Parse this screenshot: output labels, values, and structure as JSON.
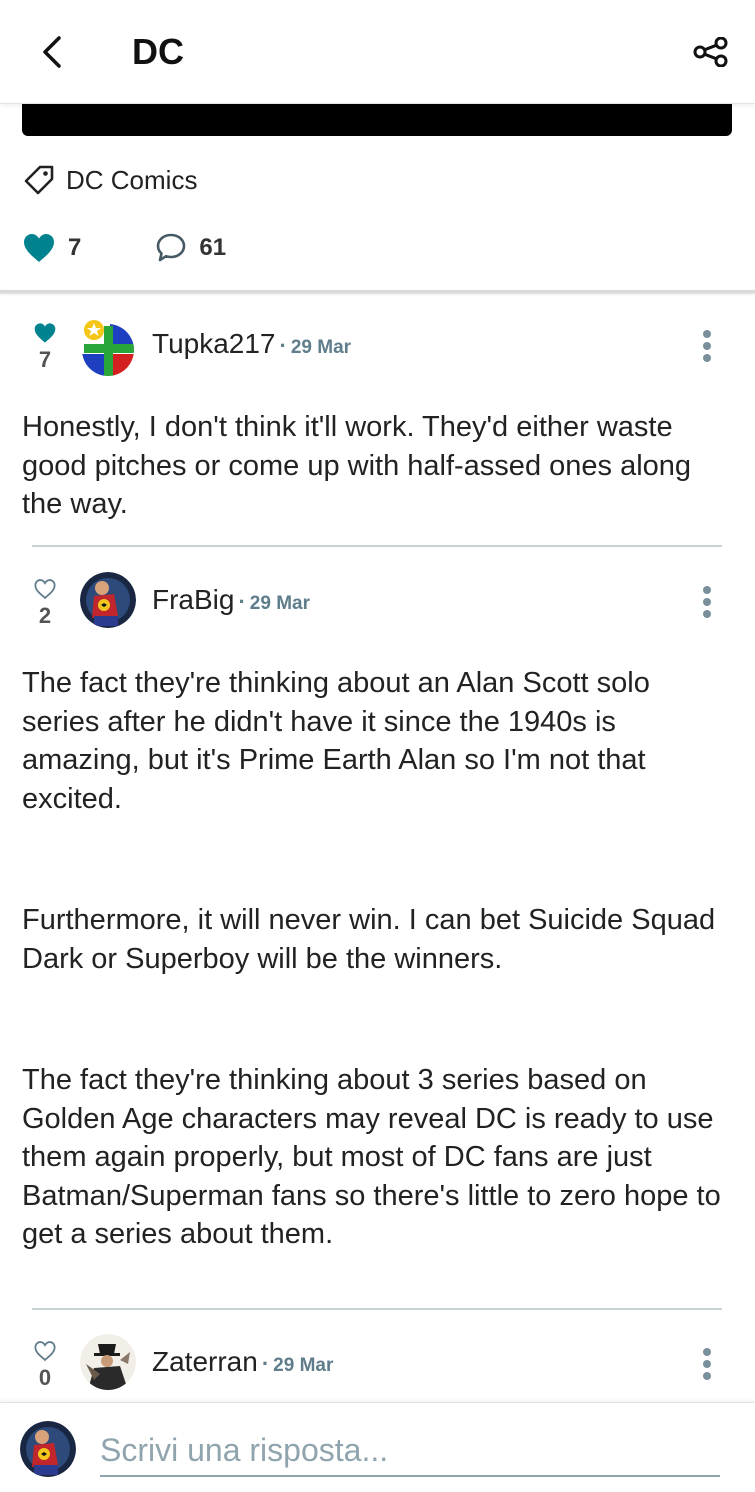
{
  "header": {
    "title": "DC",
    "back_icon": "chevron-left-icon",
    "share_icon": "share-icon"
  },
  "post": {
    "tag": "DC Comics",
    "likes": "7",
    "comments": "61"
  },
  "comments": [
    {
      "likes": "7",
      "liked": true,
      "username": "Tupka217",
      "date": "29 Mar",
      "paragraphs": [
        "Honestly, I don't think it'll work. They'd either waste good pitches or come up with half-assed ones along the way."
      ]
    },
    {
      "likes": "2",
      "liked": false,
      "username": "FraBig",
      "date": "29 Mar",
      "paragraphs": [
        "The fact they're thinking about an Alan Scott solo series after he didn't have it since the 1940s is amazing, but it's Prime Earth Alan so I'm not that excited.",
        "Furthermore, it will never win. I can bet Suicide Squad Dark or Superboy will be the winners.",
        "The fact they're thinking about 3 series based on Golden Age characters may reveal DC is ready to use them again properly, but most of DC fans are just Batman/Superman fans so there's little to zero hope to get a series about them."
      ]
    },
    {
      "likes": "0",
      "liked": false,
      "username": "Zaterran",
      "date": "29 Mar",
      "paragraphs": []
    }
  ],
  "reply": {
    "placeholder": "Scrivi una risposta..."
  },
  "colors": {
    "accent": "#00838f",
    "meta": "#607d8b",
    "divider": "#c8d3d6"
  }
}
